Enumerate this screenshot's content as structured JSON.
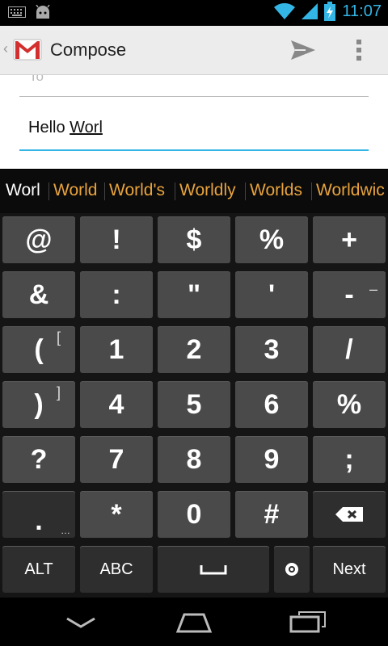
{
  "status": {
    "time": "11:07"
  },
  "action_bar": {
    "title": "Compose"
  },
  "compose": {
    "to_placeholder": "To",
    "body_prefix": "Hello ",
    "body_composing": "Worl"
  },
  "suggestions": [
    "Worl",
    "World",
    "World's",
    "Worldly",
    "Worlds",
    "Worldwic"
  ],
  "keys": {
    "row1": [
      "@",
      "!",
      "$",
      "%",
      "+"
    ],
    "row2": [
      "&",
      ":",
      "\"",
      "'",
      "-"
    ],
    "row3": [
      "(",
      "1",
      "2",
      "3",
      "/"
    ],
    "row4": [
      ")",
      "4",
      "5",
      "6",
      "%"
    ],
    "row5": [
      "?",
      "7",
      "8",
      "9",
      ";"
    ],
    "row6": [
      ".",
      "*",
      "0",
      "#"
    ],
    "hints": {
      "minus": "–",
      "open_paren": "[",
      "close_paren": "]",
      "period": "…"
    },
    "bottom": {
      "alt": "ALT",
      "abc": "ABC",
      "next": "Next"
    }
  },
  "colors": {
    "accent_blue": "#33b5e5",
    "suggestion_orange": "#e8a33d",
    "key_bg": "#4a4a4a"
  }
}
